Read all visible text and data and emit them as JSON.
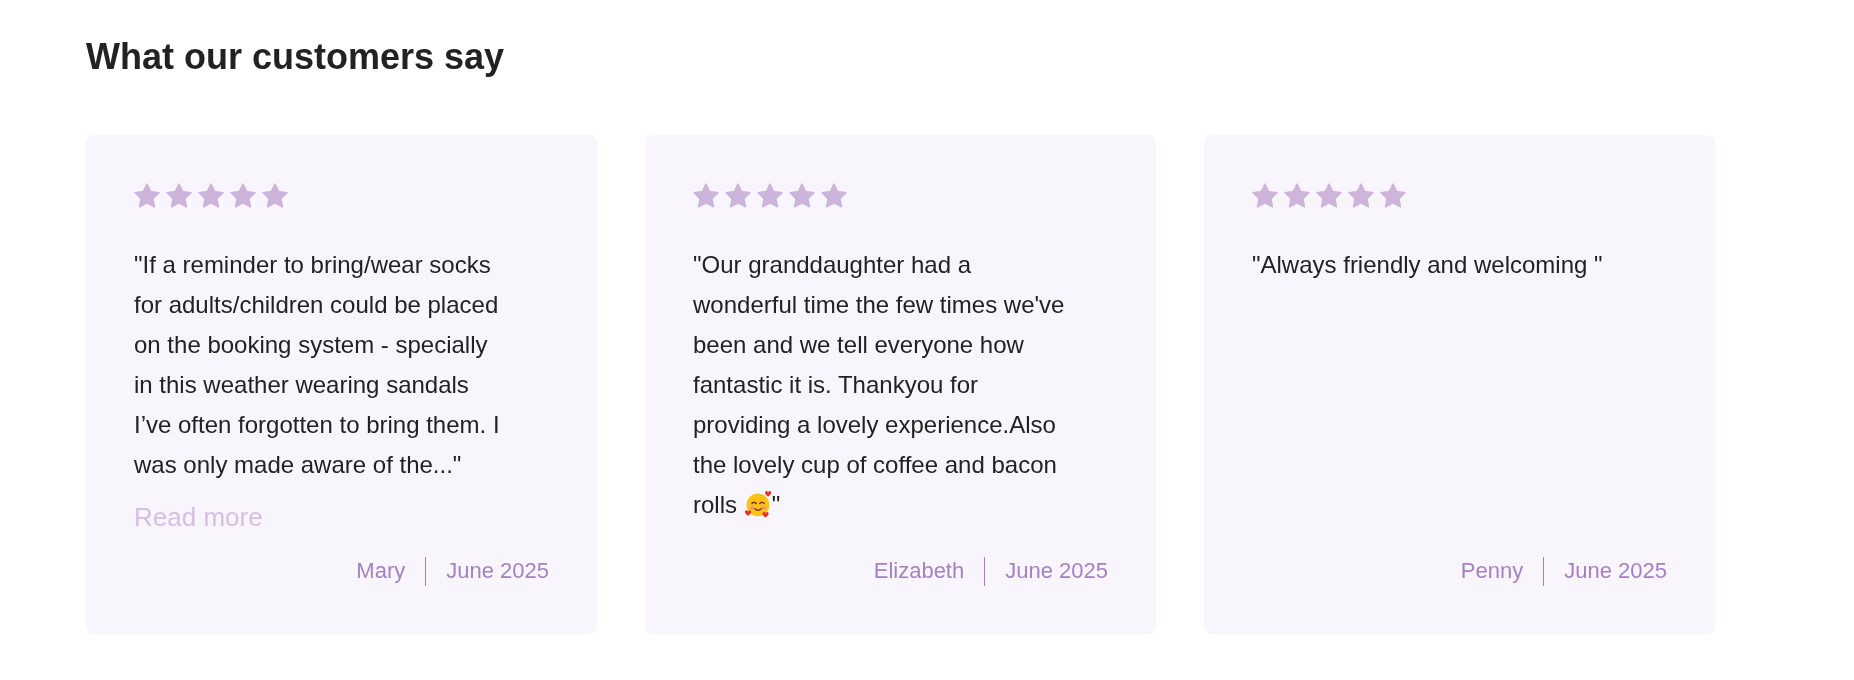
{
  "heading": "What our customers say",
  "reviews": [
    {
      "stars": 5,
      "quote": [
        {
          "kind": "text",
          "text": "\"If a reminder to bring/wear socks for adults/children could be placed on the booking system - specially in this weather wearing sandals I’ve often forgotten to bring them. I was only made aware of the...\""
        }
      ],
      "read_more": "Read more",
      "author": "Mary",
      "date": "June 2025"
    },
    {
      "stars": 5,
      "quote": [
        {
          "kind": "text",
          "text": "\"Our granddaughter had a wonderful time the few times we've been and we tell everyone how fantastic it is. Thankyou for providing a lovely experience.Also the lovely cup of coffee and bacon rolls "
        },
        {
          "kind": "emoji"
        },
        {
          "kind": "text",
          "text": "\""
        }
      ],
      "author": "Elizabeth",
      "date": "June 2025"
    },
    {
      "stars": 5,
      "quote": [
        {
          "kind": "text",
          "text": "\"Always friendly and welcoming \""
        }
      ],
      "author": "Penny",
      "date": "June 2025"
    }
  ]
}
